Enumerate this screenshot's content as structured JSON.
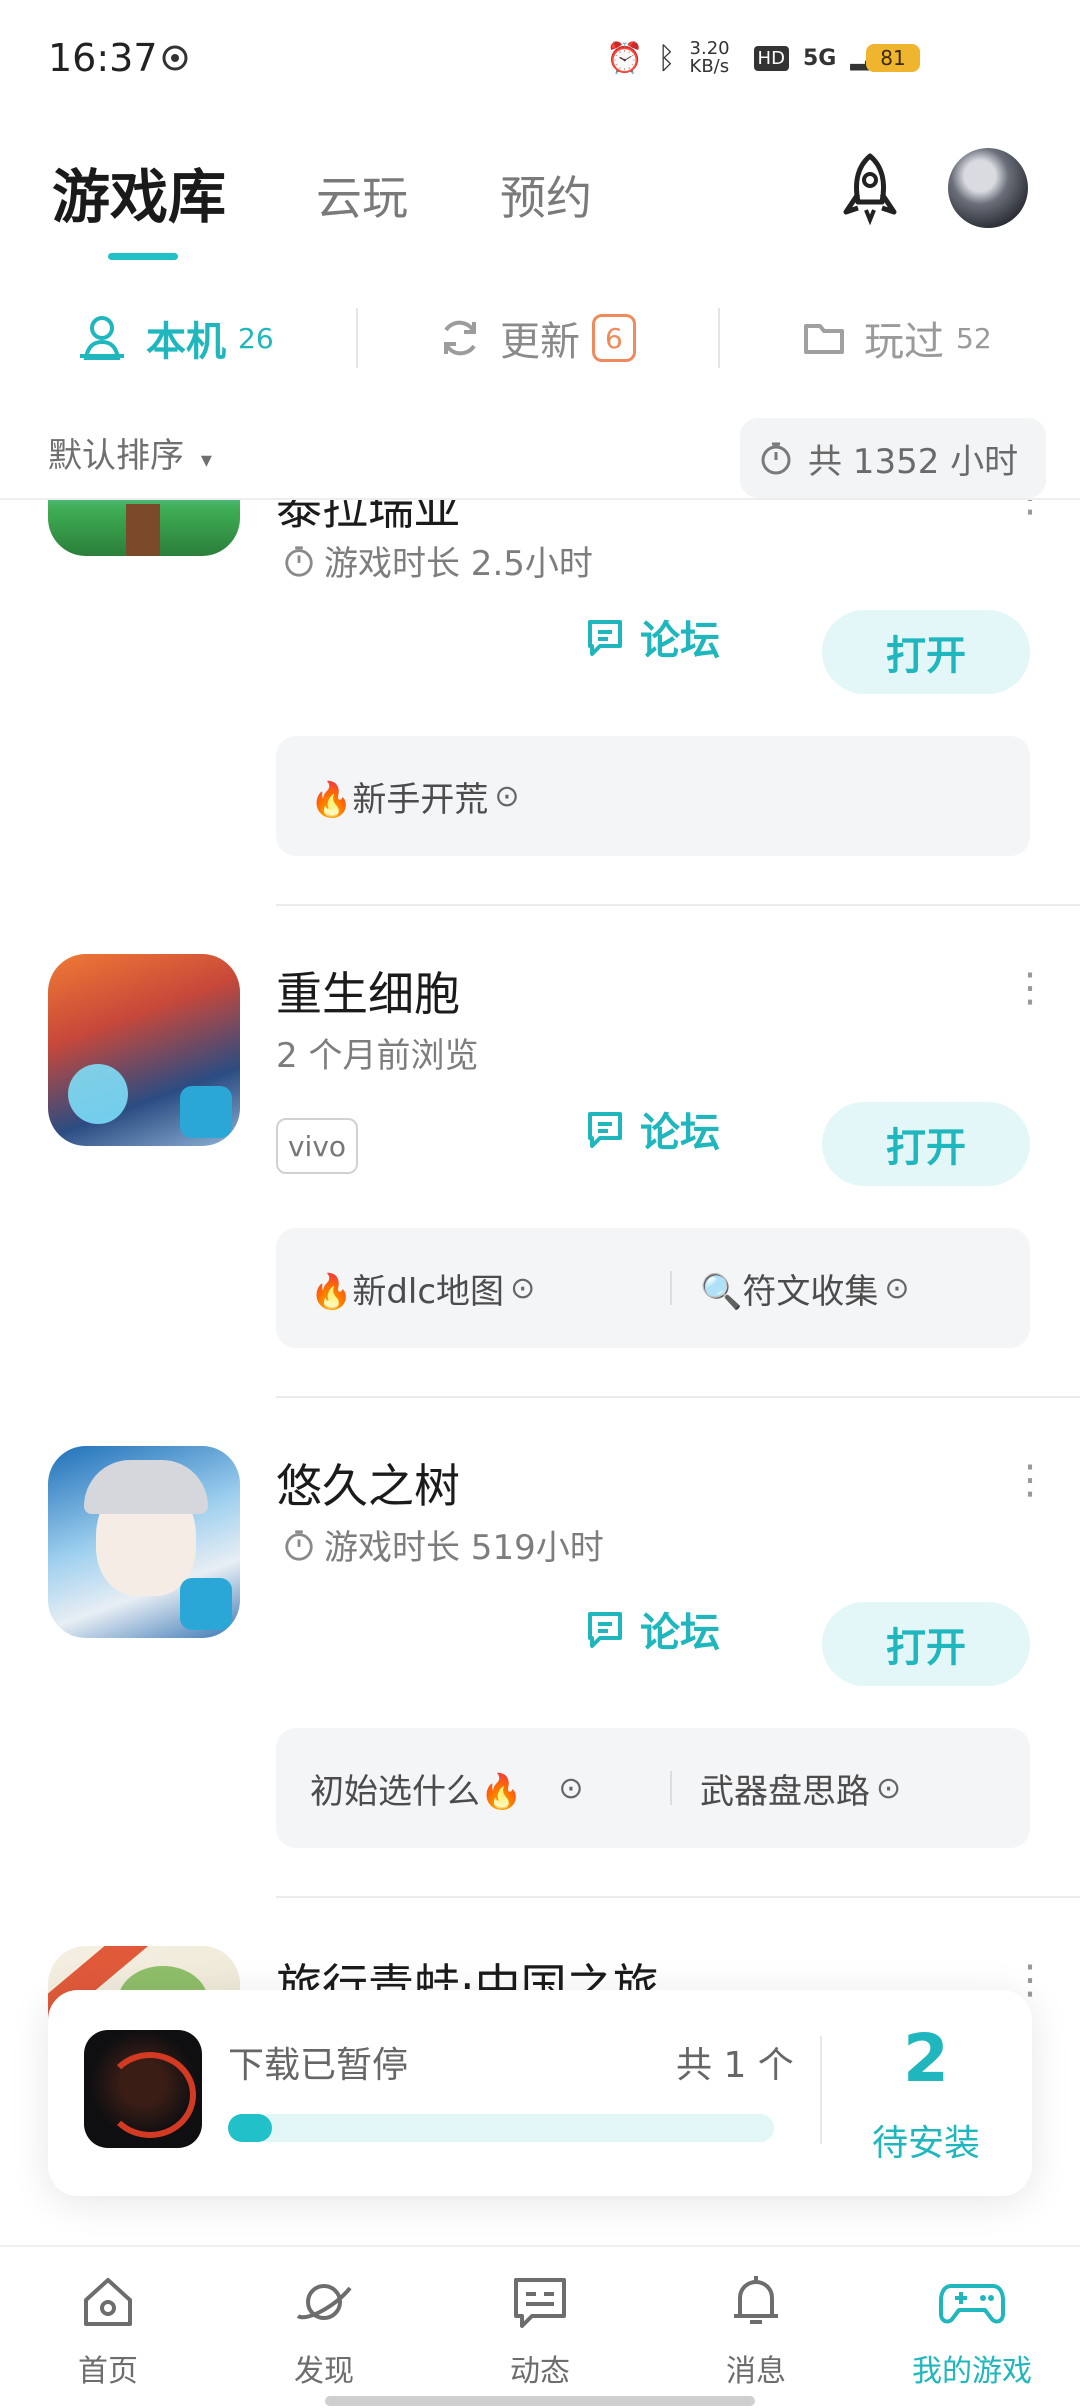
{
  "status_bar": {
    "time": "16:37",
    "net_speed": "3.20 KB/s",
    "hd": "HD",
    "network": "5G",
    "battery": "81"
  },
  "header": {
    "tabs": [
      {
        "label": "游戏库",
        "active": true
      },
      {
        "label": "云玩",
        "active": false
      },
      {
        "label": "预约",
        "active": false
      }
    ],
    "rocket_icon": "rocket-icon",
    "avatar": "avatar"
  },
  "segments": [
    {
      "label": "本机",
      "count": "26",
      "active": true,
      "icon": "person-icon"
    },
    {
      "label": "更新",
      "count": "6",
      "active": false,
      "icon": "refresh-icon"
    },
    {
      "label": "玩过",
      "count": "52",
      "active": false,
      "icon": "folder-icon"
    }
  ],
  "sort": {
    "label": "默认排序"
  },
  "total_time": "共 1352 小时",
  "games": [
    {
      "title_partial": "泰拉瑞亚",
      "meta": "游戏时长 2.5小时",
      "forum_label": "论坛",
      "open_label": "打开",
      "tips": [
        "🔥新手开荒"
      ]
    },
    {
      "title": "重生细胞",
      "meta": "2 个月前浏览",
      "tag": "vivo",
      "forum_label": "论坛",
      "open_label": "打开",
      "tips": [
        "🔥新dlc地图",
        "🔍符文收集"
      ]
    },
    {
      "title": "悠久之树",
      "meta": "游戏时长 519小时",
      "forum_label": "论坛",
      "open_label": "打开",
      "tips": [
        "初始选什么🔥",
        "武器盘思路"
      ]
    },
    {
      "title": "旅行青蛙·中国之旅"
    }
  ],
  "download": {
    "status": "下载已暂停",
    "count": "共 1 个",
    "progress": 0.08,
    "pending_number": "2",
    "pending_label": "待安装"
  },
  "nav": [
    {
      "label": "首页",
      "icon": "home-icon",
      "active": false
    },
    {
      "label": "发现",
      "icon": "planet-icon",
      "active": false
    },
    {
      "label": "动态",
      "icon": "message-icon",
      "active": false
    },
    {
      "label": "消息",
      "icon": "bell-icon",
      "active": false
    },
    {
      "label": "我的游戏",
      "icon": "gamepad-icon",
      "active": true
    }
  ],
  "colors": {
    "accent": "#1fb7bd",
    "update_badge": "#f08a5d"
  }
}
